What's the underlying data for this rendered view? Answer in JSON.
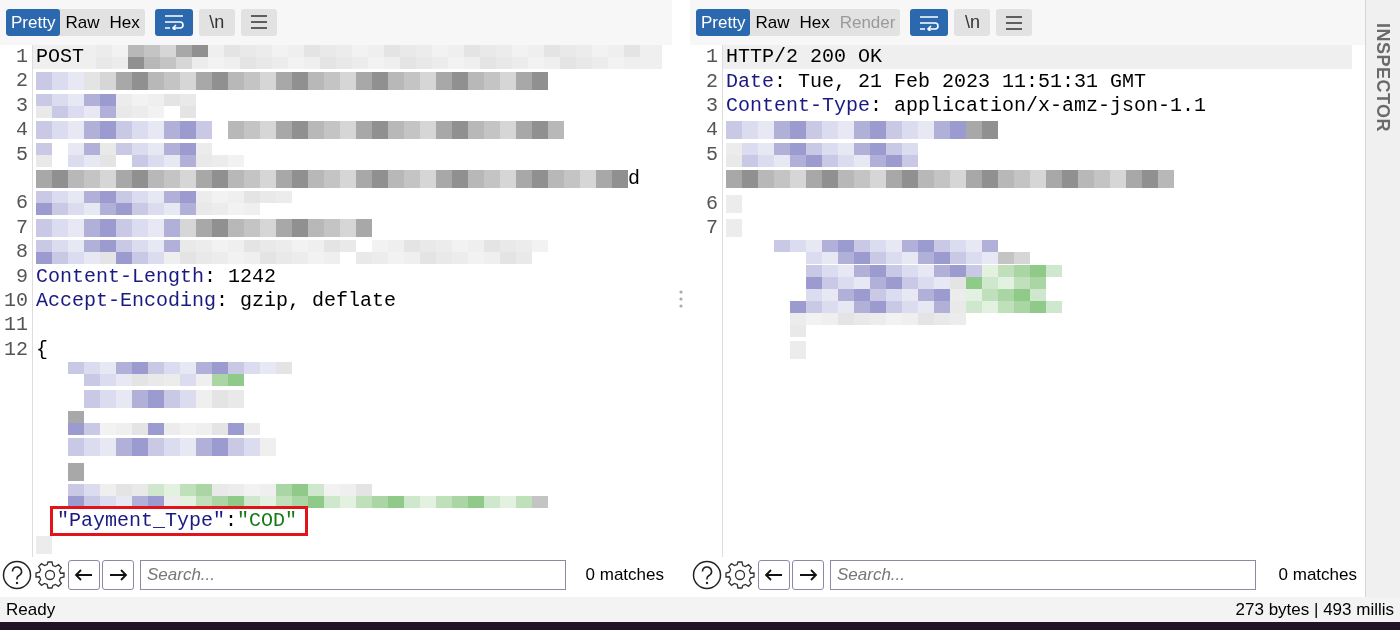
{
  "panes": [
    {
      "tabs": [
        {
          "label": "Pretty",
          "selected": true
        },
        {
          "label": "Raw",
          "selected": false
        },
        {
          "label": "Hex",
          "selected": false
        }
      ],
      "wrap_on": true,
      "newline_label": "\\n",
      "lines": [
        {
          "number": "1",
          "current": true,
          "parts": [
            {
              "kind": "plain",
              "text": "POST "
            },
            {
              "kind": "redacted"
            }
          ]
        },
        {
          "number": "2",
          "parts": [
            {
              "kind": "redacted"
            }
          ]
        },
        {
          "number": "3",
          "parts": [
            {
              "kind": "redacted"
            }
          ]
        },
        {
          "number": "4",
          "parts": [
            {
              "kind": "redacted"
            }
          ]
        },
        {
          "number": "5",
          "parts": [
            {
              "kind": "redacted"
            }
          ]
        },
        {
          "parts": [
            {
              "kind": "redacted"
            },
            {
              "kind": "plain",
              "text": "d"
            }
          ]
        },
        {
          "number": "6",
          "parts": [
            {
              "kind": "redacted"
            }
          ]
        },
        {
          "number": "7",
          "parts": [
            {
              "kind": "redacted"
            }
          ]
        },
        {
          "number": "8",
          "parts": [
            {
              "kind": "redacted"
            }
          ]
        },
        {
          "number": "9",
          "parts": [
            {
              "kind": "key",
              "text": "Content-Length"
            },
            {
              "kind": "plain",
              "text": ": 1242"
            }
          ]
        },
        {
          "number": "10",
          "parts": [
            {
              "kind": "key",
              "text": "Accept-Encoding"
            },
            {
              "kind": "plain",
              "text": ": gzip, deflate"
            }
          ]
        },
        {
          "number": "11"
        },
        {
          "number": "12",
          "parts": [
            {
              "kind": "plain",
              "text": "{"
            }
          ]
        },
        {
          "parts": [
            {
              "kind": "redacted"
            }
          ]
        },
        {
          "parts": [
            {
              "kind": "redacted"
            }
          ]
        },
        {
          "parts": [
            {
              "kind": "redacted"
            }
          ]
        },
        {
          "parts": [
            {
              "kind": "redacted"
            }
          ]
        },
        {
          "parts": [
            {
              "kind": "redacted"
            }
          ]
        },
        {
          "parts": [
            {
              "kind": "redacted"
            }
          ]
        },
        {
          "annotated": true,
          "parts": [
            {
              "kind": "key",
              "text": "\"Payment_Type\""
            },
            {
              "kind": "plain",
              "text": ":"
            },
            {
              "kind": "string",
              "text": "\"COD\""
            }
          ]
        },
        {
          "parts": [
            {
              "kind": "redacted"
            }
          ]
        }
      ],
      "search": {
        "placeholder": "Search...",
        "matches": "0 matches"
      }
    },
    {
      "tabs": [
        {
          "label": "Pretty",
          "selected": true
        },
        {
          "label": "Raw",
          "selected": false
        },
        {
          "label": "Hex",
          "selected": false
        },
        {
          "label": "Render",
          "selected": false,
          "disabled": true
        }
      ],
      "wrap_on": true,
      "newline_label": "\\n",
      "lines": [
        {
          "number": "1",
          "current": true,
          "parts": [
            {
              "kind": "plain",
              "text": "HTTP/2 200 OK"
            }
          ]
        },
        {
          "number": "2",
          "parts": [
            {
              "kind": "key",
              "text": "Date"
            },
            {
              "kind": "plain",
              "text": ": Tue, 21 Feb 2023 11:51:31 GMT"
            }
          ]
        },
        {
          "number": "3",
          "parts": [
            {
              "kind": "key",
              "text": "Content-Type"
            },
            {
              "kind": "plain",
              "text": ": application/x-amz-json-1.1"
            }
          ]
        },
        {
          "number": "4",
          "parts": [
            {
              "kind": "redacted"
            }
          ]
        },
        {
          "number": "5",
          "parts": [
            {
              "kind": "redacted"
            }
          ]
        },
        {
          "parts": [
            {
              "kind": "redacted"
            }
          ]
        },
        {
          "number": "6",
          "parts": [
            {
              "kind": "redacted"
            }
          ]
        },
        {
          "number": "7",
          "parts": [
            {
              "kind": "redacted"
            }
          ]
        },
        {
          "parts": [
            {
              "kind": "redacted"
            }
          ]
        },
        {
          "parts": [
            {
              "kind": "redacted"
            }
          ]
        },
        {
          "parts": [
            {
              "kind": "redacted"
            }
          ]
        },
        {
          "parts": [
            {
              "kind": "redacted"
            }
          ]
        },
        {
          "parts": [
            {
              "kind": "redacted"
            }
          ]
        }
      ],
      "search": {
        "placeholder": "Search...",
        "matches": "0 matches"
      }
    }
  ],
  "inspector_label": "INSPECTOR",
  "status_bar": {
    "left": "Ready",
    "right": "273 bytes | 493 millis"
  }
}
